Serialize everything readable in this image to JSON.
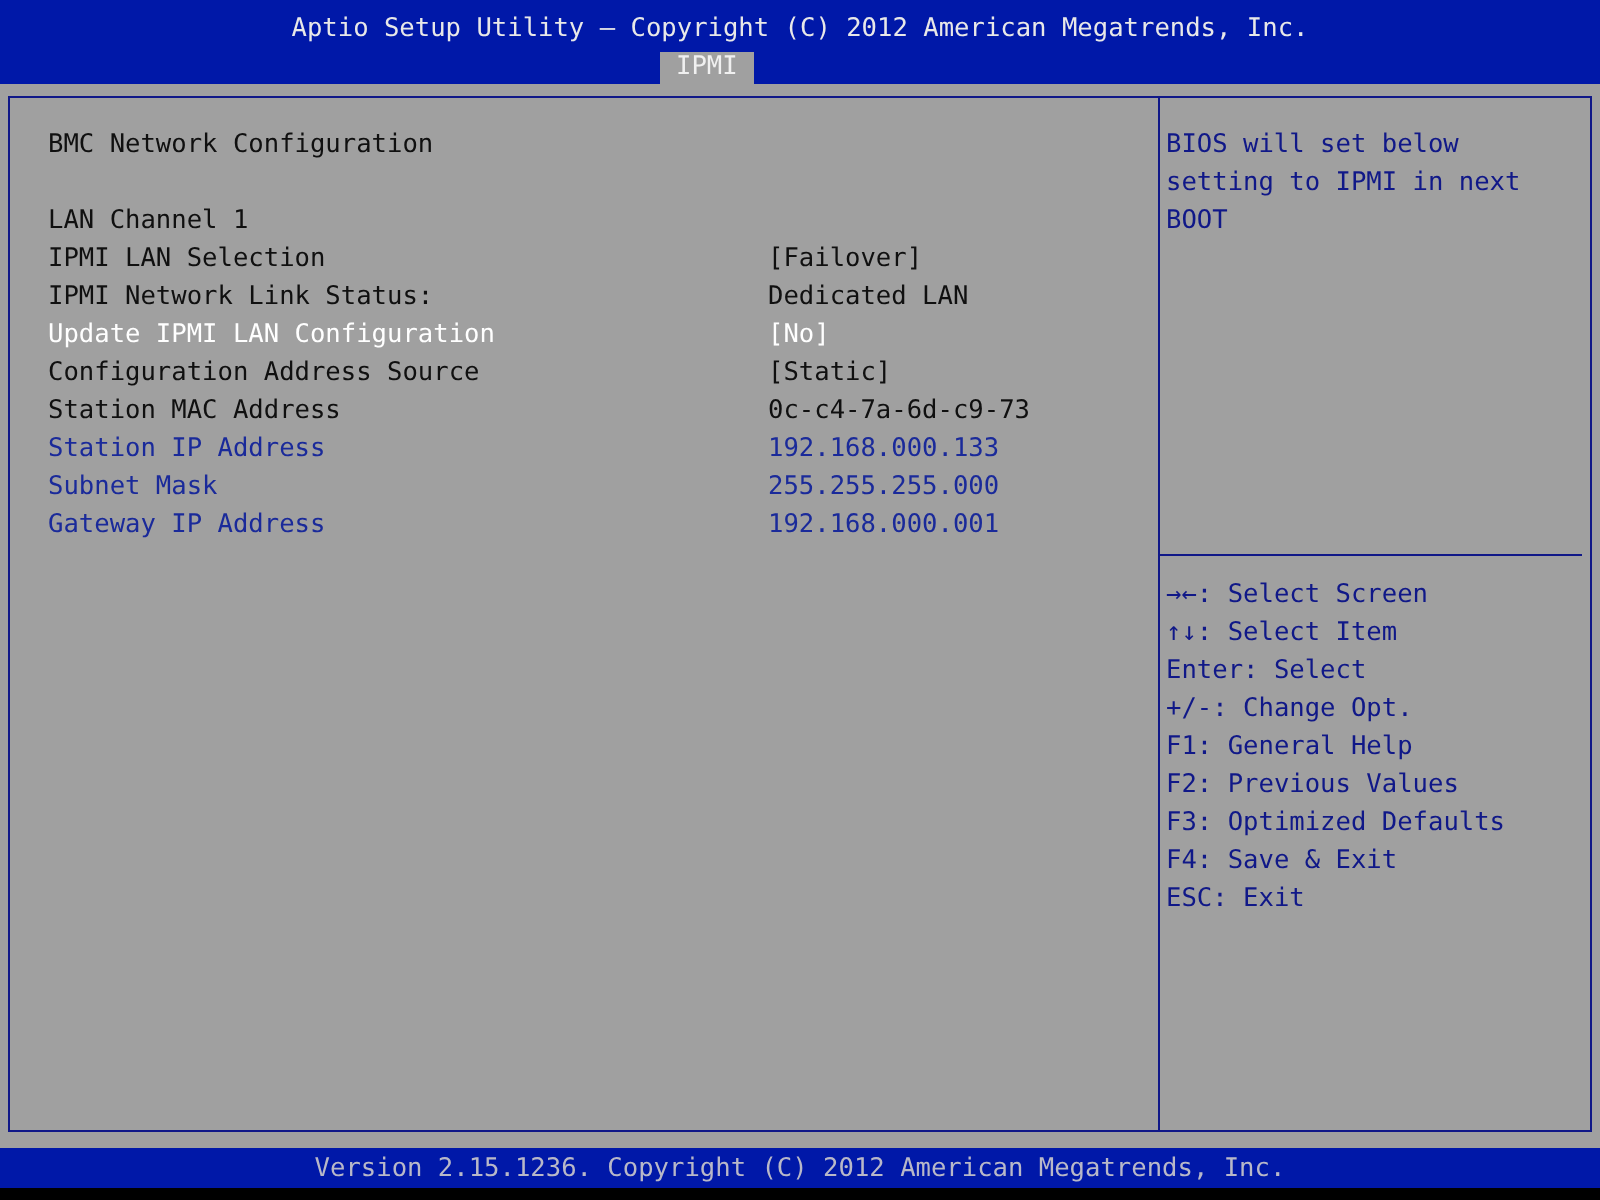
{
  "header": {
    "title": "Aptio Setup Utility – Copyright (C) 2012 American Megatrends, Inc.",
    "tabs": [
      {
        "label": "IPMI",
        "selected": true
      }
    ]
  },
  "main": {
    "section_title": "BMC Network Configuration",
    "rows": [
      {
        "label": "LAN Channel 1",
        "kind": "static",
        "selected": false
      },
      {
        "label": "IPMI LAN Selection",
        "value": "[Failover]",
        "kind": "static",
        "selected": false
      },
      {
        "label": "IPMI Network Link Status:",
        "value": "Dedicated LAN",
        "kind": "static",
        "selected": false
      },
      {
        "label": "Update IPMI LAN Configuration",
        "value": "[No]",
        "kind": "static",
        "selected": true
      },
      {
        "label": "Configuration Address Source",
        "value": "[Static]",
        "kind": "static",
        "selected": false
      },
      {
        "label": "Station MAC Address",
        "value": "0c-c4-7a-6d-c9-73",
        "kind": "static",
        "selected": false
      },
      {
        "label": "Station IP Address",
        "value": "192.168.000.133",
        "kind": "editable",
        "selected": false
      },
      {
        "label": "Subnet Mask",
        "value": "255.255.255.000",
        "kind": "editable",
        "selected": false
      },
      {
        "label": "Gateway IP Address",
        "value": "192.168.000.001",
        "kind": "editable",
        "selected": false
      }
    ]
  },
  "help": {
    "description": "BIOS will set below setting to IPMI in next BOOT",
    "keys": [
      {
        "key": "→←",
        "action": ": Select Screen"
      },
      {
        "key": "↑↓",
        "action": ": Select Item"
      },
      {
        "key": "Enter",
        "action": ": Select"
      },
      {
        "key": "+/-",
        "action": ": Change Opt."
      },
      {
        "key": "F1",
        "action": ": General Help"
      },
      {
        "key": "F2",
        "action": ": Previous Values"
      },
      {
        "key": "F3",
        "action": ": Optimized Defaults"
      },
      {
        "key": "F4",
        "action": ": Save & Exit"
      },
      {
        "key": "ESC",
        "action": ": Exit"
      }
    ]
  },
  "footer": {
    "text": "Version 2.15.1236. Copyright (C) 2012 American Megatrends, Inc."
  }
}
